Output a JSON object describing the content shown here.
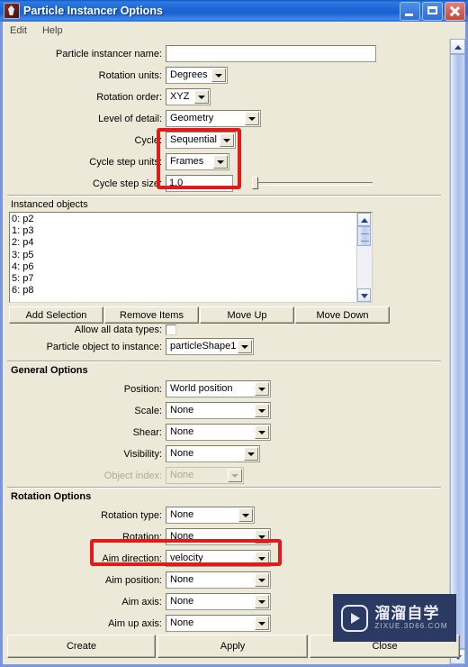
{
  "window": {
    "title": "Particle Instancer Options",
    "icon": "maya-app-icon",
    "controls": {
      "minimize": "Minimize",
      "maximize": "Maximize",
      "close": "Close"
    }
  },
  "menubar": {
    "items": [
      {
        "label": "Edit"
      },
      {
        "label": "Help"
      }
    ]
  },
  "top_fields": {
    "instancer_name": {
      "label": "Particle instancer name:",
      "value": ""
    },
    "rotation_units": {
      "label": "Rotation units:",
      "value": "Degrees"
    },
    "rotation_order": {
      "label": "Rotation order:",
      "value": "XYZ"
    },
    "level_of_detail": {
      "label": "Level of detail:",
      "value": "Geometry"
    },
    "cycle": {
      "label": "Cycle:",
      "value": "Sequential"
    },
    "cycle_step_units": {
      "label": "Cycle step units:",
      "value": "Frames"
    },
    "cycle_step_size": {
      "label": "Cycle step size:",
      "value": "1.0"
    }
  },
  "instanced_objects": {
    "label": "Instanced objects",
    "items": [
      {
        "text": "0: p2"
      },
      {
        "text": "1: p3"
      },
      {
        "text": "2: p4"
      },
      {
        "text": "3: p5"
      },
      {
        "text": "4: p6"
      },
      {
        "text": "5: p7"
      },
      {
        "text": "6: p8"
      }
    ],
    "buttons": [
      {
        "label": "Add Selection"
      },
      {
        "label": "Remove Items"
      },
      {
        "label": "Move Up"
      },
      {
        "label": "Move Down"
      }
    ]
  },
  "data_options": {
    "allow_all_data_types": {
      "label": "Allow all data types:",
      "checked": false
    },
    "particle_object": {
      "label": "Particle object to instance:",
      "value": "particleShape1"
    }
  },
  "general_options": {
    "title": "General Options",
    "fields": [
      {
        "label": "Position:",
        "value": "World position",
        "disabled": false
      },
      {
        "label": "Scale:",
        "value": "None",
        "disabled": false
      },
      {
        "label": "Shear:",
        "value": "None",
        "disabled": false
      },
      {
        "label": "Visibility:",
        "value": "None",
        "disabled": false
      },
      {
        "label": "Object index:",
        "value": "None",
        "disabled": true
      }
    ]
  },
  "rotation_options": {
    "title": "Rotation Options",
    "fields": [
      {
        "label": "Rotation type:",
        "value": "None",
        "disabled": false
      },
      {
        "label": "Rotation:",
        "value": "None",
        "disabled": false
      },
      {
        "label": "Aim direction:",
        "value": "velocity",
        "disabled": false
      },
      {
        "label": "Aim position:",
        "value": "None",
        "disabled": false
      },
      {
        "label": "Aim axis:",
        "value": "None",
        "disabled": false
      },
      {
        "label": "Aim up axis:",
        "value": "None",
        "disabled": false
      }
    ]
  },
  "bottom_buttons": [
    {
      "label": "Create"
    },
    {
      "label": "Apply"
    },
    {
      "label": "Close"
    }
  ],
  "annotations": {
    "cycle_group": "red-highlight-cycle-settings",
    "aim_direction": "red-highlight-aim-direction",
    "color": "#e31a1a"
  },
  "watermark": {
    "title_cn": "溜溜自学",
    "title_en": "ZIXUE.3D66.COM"
  }
}
